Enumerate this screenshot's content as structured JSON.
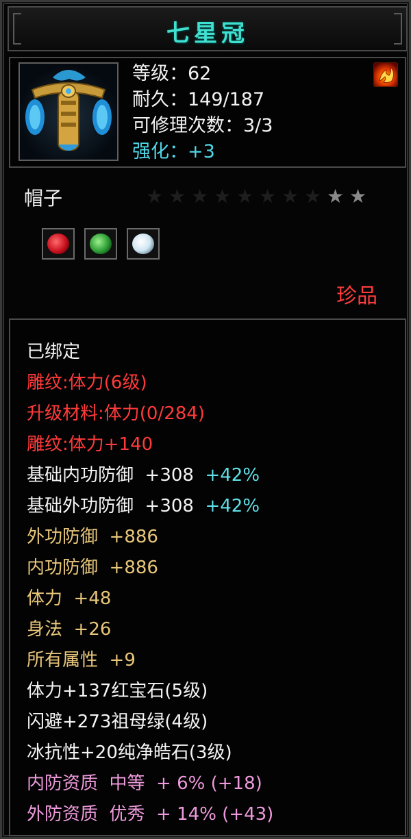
{
  "title": "七星冠",
  "stats": {
    "level": "等级：62",
    "durability": "耐久：149/187",
    "repairs": "可修理次数：3/3",
    "enhance": "强化：+3"
  },
  "icons": {
    "item": "blue-winged-crown-icon",
    "corner": "flame-icon"
  },
  "type": "帽子",
  "stars": {
    "total": 10,
    "filled": 2
  },
  "gems": [
    {
      "name": "ruby-gem-icon",
      "color": "#c8101e"
    },
    {
      "name": "emerald-gem-icon",
      "color": "#2a9a32"
    },
    {
      "name": "diamond-gem-icon",
      "color": "#cfe6f2"
    }
  ],
  "rarity": "珍品",
  "bound": "已绑定",
  "engrave": {
    "line1": "雕纹:体力(6级)",
    "line2": "升级材料:体力(0/284)",
    "line3": "雕纹:体力+140"
  },
  "base": [
    {
      "label": "基础内功防御  +308",
      "bonus": "+42%"
    },
    {
      "label": "基础外功防御  +308",
      "bonus": "+42%"
    }
  ],
  "bonus_attrs": [
    "外功防御  +886",
    "内功防御  +886",
    "体力  +48",
    "身法  +26",
    "所有属性  +9"
  ],
  "gem_attrs": [
    "体力+137红宝石(5级)",
    "闪避+273祖母绿(4级)",
    "冰抗性+20纯净皓石(3级)"
  ],
  "quality": [
    "内防资质  中等  + 6% (+18)",
    "外防资质  优秀  + 14% (+43)"
  ],
  "colors": {
    "title": "#3fe0d0",
    "red": "#ff3a3a",
    "gold": "#e8c67a",
    "pink": "#ee9adc",
    "cyan": "#5fe0e8",
    "star_filled": "#8a8a8a",
    "star_empty": "#1e1e1e"
  }
}
